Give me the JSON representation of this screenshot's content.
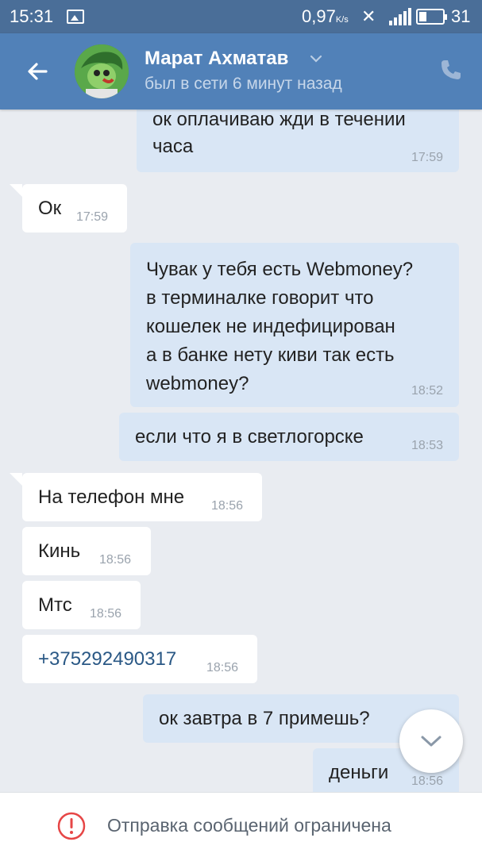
{
  "status_bar": {
    "time": "15:31",
    "network_speed": "0,97",
    "network_unit": "K/s",
    "battery": "31"
  },
  "header": {
    "contact_name": "Марат Ахматав",
    "last_seen": "был в сети 6 минут назад",
    "accent_color": "#5181b8"
  },
  "messages": [
    {
      "dir": "out",
      "text": "ок оплачиваю жди в течении\nчаса",
      "time": "17:59"
    },
    {
      "dir": "in",
      "text": "Ок",
      "time": "17:59"
    },
    {
      "dir": "out",
      "text": "Чувак у тебя есть Webmoney?\nв терминалке говорит что\nкошелек не индефицирован\nа в банке нету киви так есть\nwebmoney?",
      "time": "18:52"
    },
    {
      "dir": "out",
      "text": "если что я в светлогорске",
      "time": "18:53"
    },
    {
      "dir": "in",
      "text": "На телефон мне",
      "time": "18:56"
    },
    {
      "dir": "in",
      "text": "Кинь",
      "time": "18:56"
    },
    {
      "dir": "in",
      "text": "Мтс",
      "time": "18:56"
    },
    {
      "dir": "in",
      "text": "+375292490317",
      "time": "18:56",
      "is_link": true
    },
    {
      "dir": "out",
      "text": "ок завтра в 7 примешь?",
      "time": ""
    },
    {
      "dir": "out",
      "text": "деньги",
      "time": "18:56"
    }
  ],
  "footer": {
    "notice": "Отправка сообщений ограничена"
  }
}
